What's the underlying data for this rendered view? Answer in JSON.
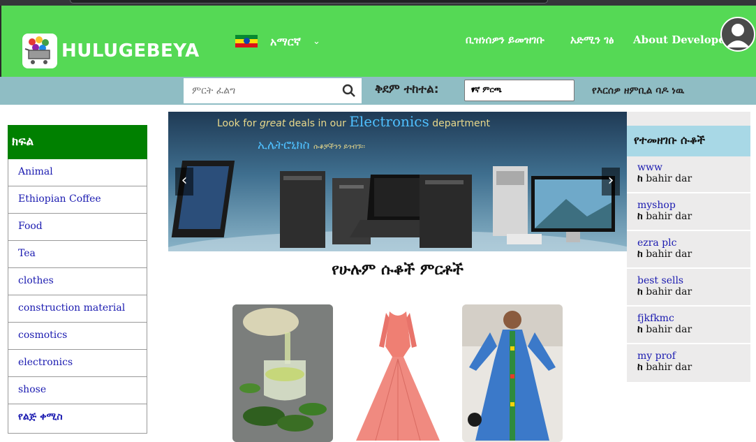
{
  "header": {
    "brand": "HULUGEBEYA",
    "language": "አማርኛ",
    "nav": [
      "ቢዝነሰዎን ይመዝገቡ",
      "አድሚን ገፅ",
      "About Developer"
    ]
  },
  "search": {
    "placeholder": "ምርት ፈልግ",
    "sort_label": "ቅደም ተከተል:",
    "sort_selected": "የኛ ምርጫ",
    "not_registered": "የእርሰዎ ዘምቢል ባዶ ነዉ"
  },
  "categories": {
    "title": "ክፍል",
    "items": [
      "Animal",
      "Ethiopian Coffee",
      "Food",
      "Tea",
      "clothes",
      "construction material",
      "cosmotics",
      "electronics",
      "shose",
      "የልጅ ቀሚስ"
    ]
  },
  "banner": {
    "line1_a": "Look for",
    "line1_b": "great",
    "line1_c": "deals in our",
    "line1_d": "Electronics",
    "line1_e": "department",
    "line2_a": "ኢሌትሮኒክስ",
    "line2_b": "ሱቆቻችንን ይጎብኙ፡፡"
  },
  "section_title": "የሁሉም ሱቆች ምርቶች",
  "shops": {
    "title": "የተመዘገቡ ሱቆች",
    "loc_prefix": "ከ",
    "items": [
      {
        "name": "www",
        "location": "bahir dar"
      },
      {
        "name": "myshop",
        "location": "bahir dar"
      },
      {
        "name": "ezra plc",
        "location": "bahir dar"
      },
      {
        "name": "best sells",
        "location": "bahir dar"
      },
      {
        "name": "fjkfkmc",
        "location": "bahir dar"
      },
      {
        "name": "my prof",
        "location": "bahir dar"
      }
    ]
  },
  "colors": {
    "header_green": "#55d955",
    "category_green": "#008000",
    "link_blue": "#1a1ab0"
  }
}
